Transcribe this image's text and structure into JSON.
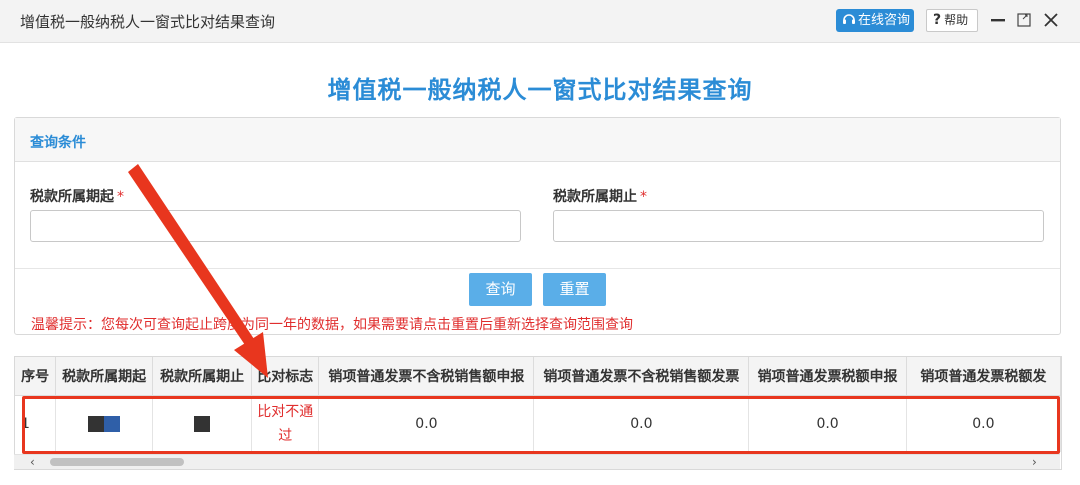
{
  "window": {
    "title": "增值税一般纳税人一窗式比对结果查询",
    "consult_label": "在线咨询",
    "help_label": "帮助"
  },
  "page": {
    "heading": "增值税一般纳税人一窗式比对结果查询"
  },
  "query": {
    "panel_title": "查询条件",
    "start_label": "税款所属期起",
    "end_label": "税款所属期止",
    "required_mark": "*",
    "start_value": "",
    "end_value": "",
    "query_button": "查询",
    "reset_button": "重置",
    "tip": "温馨提示：您每次可查询起止跨度为同一年的数据，如果需要请点击重置后重新选择查询范围查询"
  },
  "table": {
    "headers": [
      "序号",
      "税款所属期起",
      "税款所属期止",
      "比对标志",
      "销项普通发票不含税销售额申报",
      "销项普通发票不含税销售额发票",
      "销项普通发票税额申报",
      "销项普通发票税额发"
    ],
    "rows": [
      {
        "index": "1",
        "flag": "比对不通过",
        "values": [
          "0.0",
          "0.0",
          "0.0",
          "0.0"
        ]
      }
    ]
  },
  "scrollbar": {
    "left_arrow": "‹",
    "right_arrow": "›"
  },
  "colors": {
    "accent": "#2b8cd6",
    "button": "#5aaee8",
    "alert": "#e02e2e",
    "annotation": "#e8361e"
  }
}
